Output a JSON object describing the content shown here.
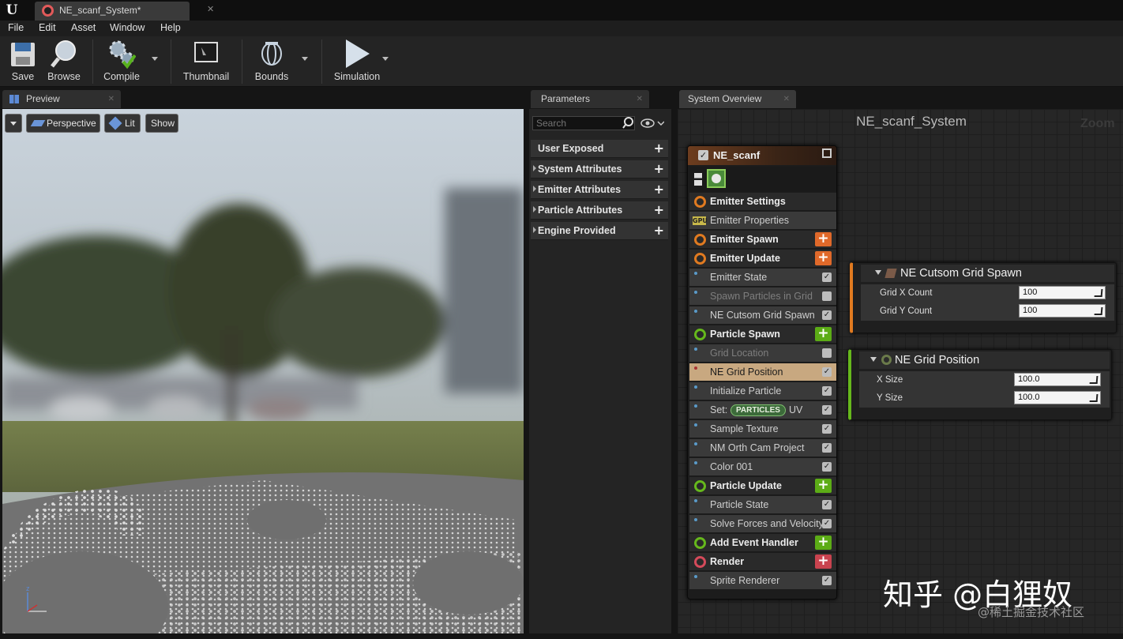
{
  "window": {
    "doc_tab": "NE_scanf_System*"
  },
  "menu": [
    "File",
    "Edit",
    "Asset",
    "Window",
    "Help"
  ],
  "toolbar": {
    "save": "Save",
    "browse": "Browse",
    "compile": "Compile",
    "thumbnail": "Thumbnail",
    "bounds": "Bounds",
    "simulation": "Simulation"
  },
  "preview": {
    "tab": "Preview",
    "buttons": {
      "perspective": "Perspective",
      "lit": "Lit",
      "show": "Show"
    }
  },
  "parameters": {
    "tab": "Parameters",
    "search_placeholder": "Search",
    "categories": [
      "User Exposed",
      "System Attributes",
      "Emitter Attributes",
      "Particle Attributes",
      "Engine Provided"
    ]
  },
  "overview": {
    "tab": "System Overview",
    "system_name": "NE_scanf_System",
    "zoom": "Zoom"
  },
  "emitter": {
    "name": "NE_scanf",
    "rows": [
      {
        "label": "Emitter Settings",
        "kind": "header",
        "color": "#e07a20"
      },
      {
        "label": "Emitter Properties",
        "kind": "item",
        "badge": "GPU"
      },
      {
        "label": "Emitter Spawn",
        "kind": "header",
        "color": "#e07a20",
        "add": "#e0692a"
      },
      {
        "label": "Emitter Update",
        "kind": "header",
        "color": "#e07a20",
        "add": "#e0692a"
      },
      {
        "label": "Emitter State",
        "kind": "item",
        "checked": true
      },
      {
        "label": "Spawn Particles in Grid",
        "kind": "item",
        "checked": false,
        "dim": true
      },
      {
        "label": "NE Cutsom Grid Spawn",
        "kind": "item",
        "checked": true
      },
      {
        "label": "Particle Spawn",
        "kind": "header",
        "color": "#66b81c",
        "add": "#5cac16"
      },
      {
        "label": "Grid Location",
        "kind": "item",
        "checked": false,
        "dim": true
      },
      {
        "label": "NE Grid Position",
        "kind": "item",
        "checked": true,
        "selected": true
      },
      {
        "label": "Initialize Particle",
        "kind": "item",
        "checked": true
      },
      {
        "label": "Set:",
        "kind": "item",
        "checked": true,
        "pill": "PARTICLES",
        "suffix": "UV"
      },
      {
        "label": "Sample Texture",
        "kind": "item",
        "checked": true
      },
      {
        "label": "NM Orth Cam Project",
        "kind": "item",
        "checked": true
      },
      {
        "label": "Color 001",
        "kind": "item",
        "checked": true
      },
      {
        "label": "Particle Update",
        "kind": "header",
        "color": "#66b81c",
        "add": "#5cac16"
      },
      {
        "label": "Particle State",
        "kind": "item",
        "checked": true
      },
      {
        "label": "Solve Forces and Velocity",
        "kind": "item",
        "checked": true
      },
      {
        "label": "Add Event Handler",
        "kind": "header",
        "color": "#66b81c",
        "add": "#5cac16"
      },
      {
        "label": "Render",
        "kind": "header",
        "color": "#d44a5a",
        "add": "#c9434f"
      },
      {
        "label": "Sprite Renderer",
        "kind": "item",
        "checked": true
      }
    ]
  },
  "grid_spawn": {
    "title": "NE Cutsom Grid Spawn",
    "fields": [
      {
        "label": "Grid X Count",
        "value": "100"
      },
      {
        "label": "Grid Y Count",
        "value": "100"
      }
    ]
  },
  "grid_position": {
    "title": "NE Grid Position",
    "fields": [
      {
        "label": "X Size",
        "value": "100.0"
      },
      {
        "label": "Y Size",
        "value": "100.0"
      }
    ]
  },
  "watermark": {
    "main": "知乎 @白狸奴",
    "sub": "@稀土掘金技术社区"
  },
  "colors": {
    "accent_orange": "#e07a20",
    "accent_green": "#66b81c",
    "render_red": "#d44a5a",
    "selected_row": "#c8a880"
  }
}
